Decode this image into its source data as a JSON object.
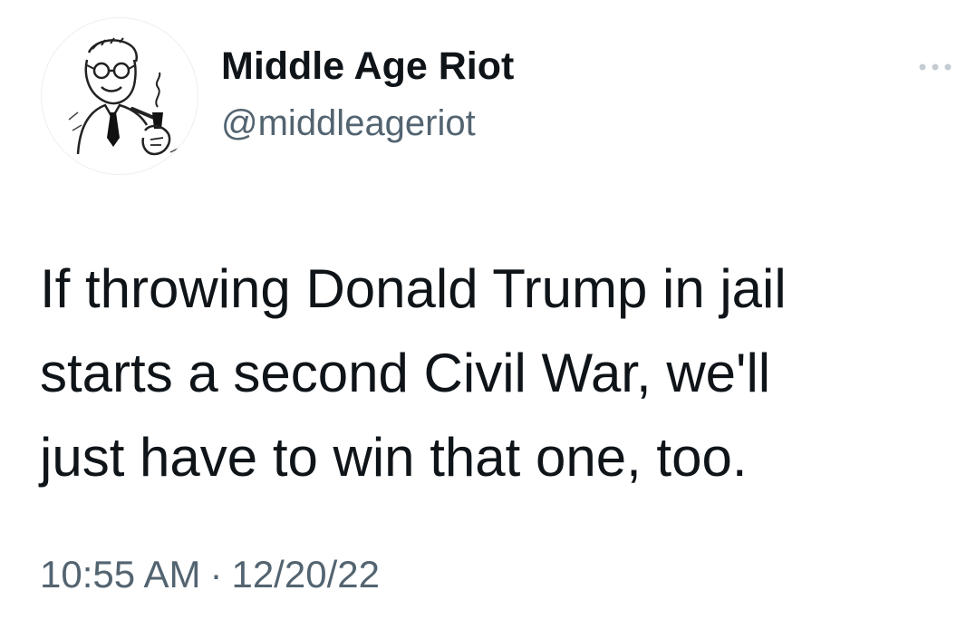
{
  "tweet": {
    "author": {
      "display_name": "Middle Age Riot",
      "handle": "@middleageriot",
      "avatar_icon": "vintage-man-with-pipe-illustration"
    },
    "more_icon": "more-horizontal-icon",
    "text": "If throwing Donald Trump in jail\nstarts a second Civil War, we'll\njust have to win that one, too.",
    "time": "10:55 AM",
    "separator": "·",
    "date": "12/20/22"
  },
  "colors": {
    "text_primary": "#0f1419",
    "text_secondary": "#536471",
    "background": "#ffffff"
  }
}
